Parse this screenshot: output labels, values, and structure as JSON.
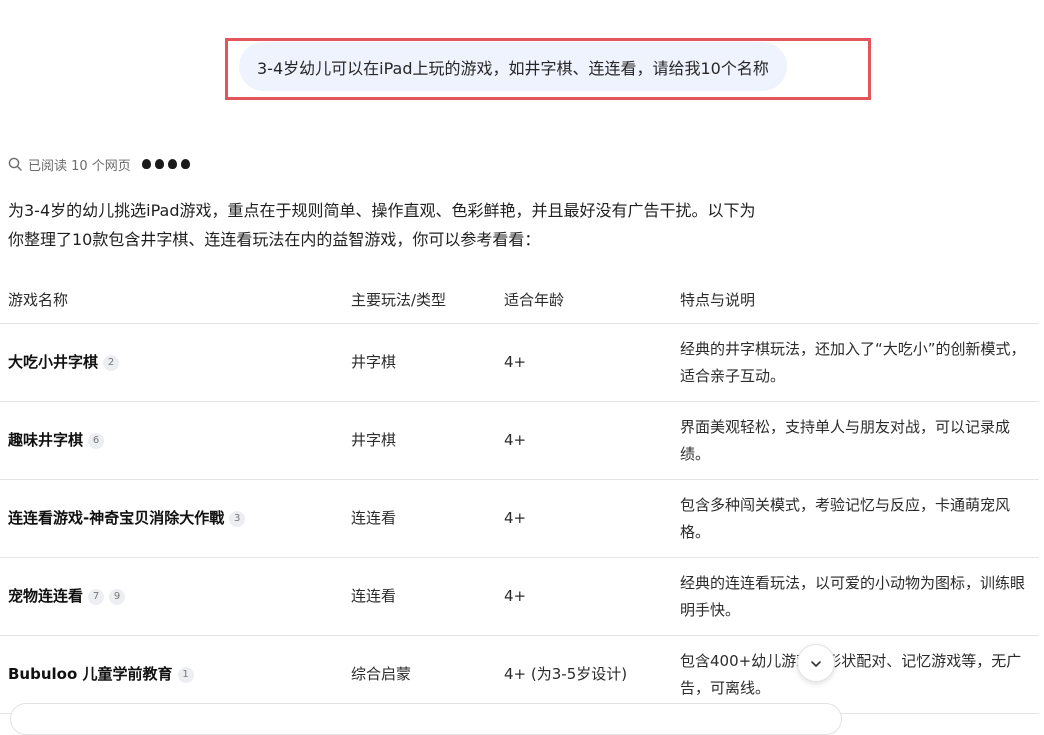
{
  "user_message": "3-4岁幼儿可以在iPad上玩的游戏，如井字棋、连连看，请给我10个名称",
  "reading_status": "已阅读 10 个网页",
  "source_icons": [
    "apple-icon",
    "apple-icon",
    "apple-icon",
    "apple-icon"
  ],
  "intro_line1": "为3-4岁的幼儿挑选iPad游戏，重点在于规则简单、操作直观、色彩鲜艳，并且最好没有广告干扰。以下为",
  "intro_line2": "你整理了10款包含井字棋、连连看玩法在内的益智游戏，你可以参考看看：",
  "table": {
    "headers": [
      "游戏名称",
      "主要玩法/类型",
      "适合年龄",
      "特点与说明"
    ],
    "rows": [
      {
        "name": "大吃小井字棋",
        "citations": [
          "2"
        ],
        "type": "井字棋",
        "age": "4+",
        "desc": "经典的井字棋玩法，还加入了“大吃小”的创新模式，适合亲子互动。"
      },
      {
        "name": "趣味井字棋",
        "citations": [
          "6"
        ],
        "type": "井字棋",
        "age": "4+",
        "desc": "界面美观轻松，支持单人与朋友对战，可以记录成绩。"
      },
      {
        "name": "连连看游戏-神奇宝贝消除大作戰",
        "citations": [
          "3"
        ],
        "type": "连连看",
        "age": "4+",
        "desc": "包含多种闯关模式，考验记忆与反应，卡通萌宠风格。"
      },
      {
        "name": "宠物连连看",
        "citations": [
          "7",
          "9"
        ],
        "type": "连连看",
        "age": "4+",
        "desc": "经典的连连看玩法，以可爱的小动物为图标，训练眼明手快。"
      },
      {
        "name": "Bubuloo 儿童学前教育",
        "citations": [
          "1"
        ],
        "type": "综合启蒙",
        "age": "4+ (为3-5岁设计)",
        "desc": "包含400+幼儿游戏，形状配对、记忆游戏等，无广告，可离线。"
      }
    ]
  }
}
